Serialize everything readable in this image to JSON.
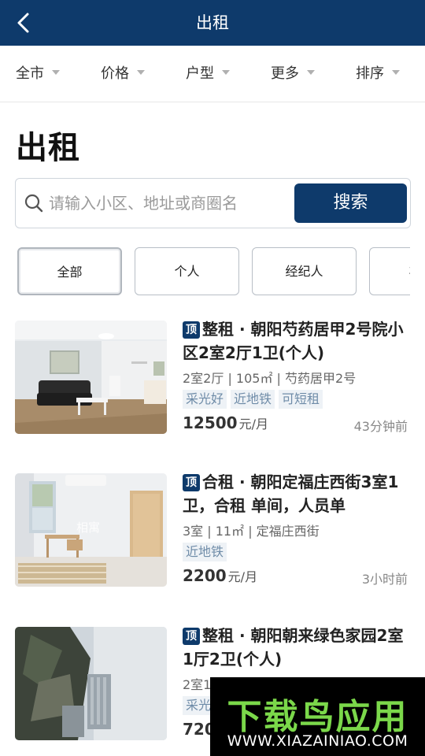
{
  "header": {
    "title": "出租"
  },
  "filters": [
    {
      "label": "全市"
    },
    {
      "label": "价格"
    },
    {
      "label": "户型"
    },
    {
      "label": "更多"
    },
    {
      "label": "排序"
    }
  ],
  "page_title": "出租",
  "search": {
    "placeholder": "请输入小区、地址或商圈名",
    "button_label": "搜索"
  },
  "chips": [
    {
      "label": "全部",
      "active": true
    },
    {
      "label": "个人",
      "active": false
    },
    {
      "label": "经纪人",
      "active": false
    },
    {
      "label": "非中",
      "active": false
    }
  ],
  "listings": [
    {
      "badge": "顶",
      "title": "整租 · 朝阳芍药居甲2号院小区2室2厅1卫(个人)",
      "info": "2室2厅 | 105㎡ | 芍药居甲2号",
      "tags": [
        "采光好",
        "近地铁",
        "可短租"
      ],
      "price": "12500",
      "unit": "元/月",
      "time": "43分钟前"
    },
    {
      "badge": "顶",
      "title": "合租 · 朝阳定福庄西街3室1卫，合租 单间，人员单",
      "info": "3室 | 11㎡ | 定福庄西街",
      "tags": [
        "近地铁"
      ],
      "price": "2200",
      "unit": "元/月",
      "time": "3小时前",
      "photo_watermark": "相寓"
    },
    {
      "badge": "顶",
      "title": "整租 · 朝阳朝来绿色家园2室1厅2卫(个人)",
      "info": "2室1",
      "tags": [
        "采光"
      ],
      "price": "720",
      "unit": "",
      "time": ""
    }
  ],
  "watermark": {
    "line1": "下载鸟应用",
    "line2": "WWW.XIAZAINIAO.COM"
  },
  "colors": {
    "brand": "#0e3a6b",
    "tag_bg": "#eef2f6",
    "tag_text": "#6f8ca8"
  }
}
